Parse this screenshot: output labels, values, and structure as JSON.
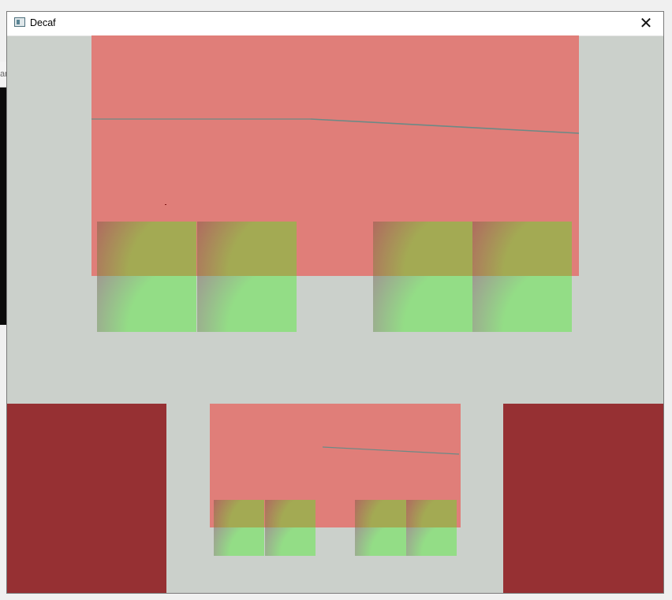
{
  "window": {
    "title": "Decaf",
    "close_glyph": "✕",
    "icon": "app-window-icon"
  },
  "background_window": {
    "partial_text": "an"
  },
  "colors": {
    "canvas_bg": "#cbd0cb",
    "red_panel": "#e07e79",
    "dark_red": "#963033",
    "yellow_tile": "#a3aa53",
    "green_tile": "#93dd86",
    "line": "#6b8a86"
  }
}
